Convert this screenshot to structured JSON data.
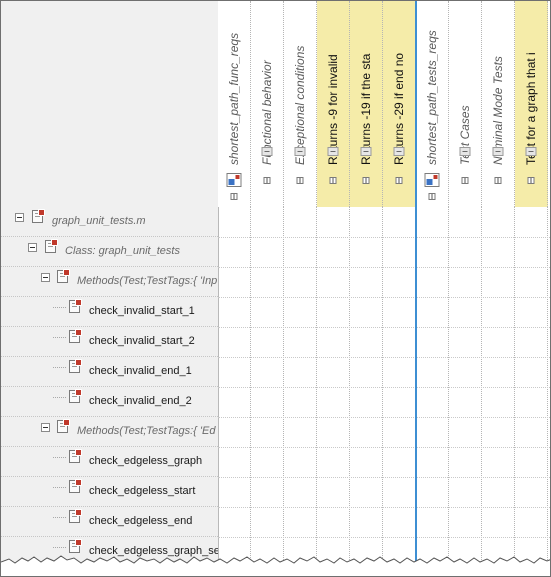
{
  "columns": [
    {
      "label": "shortest_path_func_reqs",
      "kind": "set",
      "style": "white"
    },
    {
      "label": "Functional behavior",
      "kind": "req",
      "style": "white"
    },
    {
      "label": "Exceptional conditions",
      "kind": "req",
      "style": "white"
    },
    {
      "label": "Returns -9 for invalid",
      "kind": "req",
      "style": "yellow"
    },
    {
      "label": "Returns -19 if the sta",
      "kind": "req",
      "style": "yellow"
    },
    {
      "label": "Returns -29 if end no",
      "kind": "req",
      "style": "yellow"
    },
    {
      "label": "shortest_path_tests_reqs",
      "kind": "set",
      "style": "white"
    },
    {
      "label": "Test Cases",
      "kind": "req",
      "style": "white"
    },
    {
      "label": "Nominal Mode Tests",
      "kind": "req",
      "style": "white"
    },
    {
      "label": "Test for a graph that i",
      "kind": "req",
      "style": "yellow"
    }
  ],
  "tree": [
    {
      "label": "graph_unit_tests.m",
      "type": "file",
      "expander": true,
      "italic": true
    },
    {
      "label": "Class: graph_unit_tests",
      "type": "class",
      "expander": true,
      "italic": true
    },
    {
      "label": "Methods(Test;TestTags:{ 'Inp",
      "type": "group",
      "expander": true,
      "italic": true
    },
    {
      "label": "check_invalid_start_1",
      "type": "test",
      "expander": false,
      "italic": false
    },
    {
      "label": "check_invalid_start_2",
      "type": "test",
      "expander": false,
      "italic": false
    },
    {
      "label": "check_invalid_end_1",
      "type": "test",
      "expander": false,
      "italic": false
    },
    {
      "label": "check_invalid_end_2",
      "type": "test",
      "expander": false,
      "italic": false
    },
    {
      "label": "Methods(Test;TestTags:{ 'Ed",
      "type": "group",
      "expander": true,
      "italic": true
    },
    {
      "label": "check_edgeless_graph",
      "type": "test",
      "expander": false,
      "italic": false
    },
    {
      "label": "check_edgeless_start",
      "type": "test",
      "expander": false,
      "italic": false
    },
    {
      "label": "check_edgeless_end",
      "type": "test",
      "expander": false,
      "italic": false
    },
    {
      "label": "check_edgeless_graph_se",
      "type": "test",
      "expander": false,
      "italic": false
    }
  ],
  "colors": {
    "yellow": "#f5eca9",
    "divider": "#3e8fd3",
    "panel": "#f0f0f0"
  }
}
